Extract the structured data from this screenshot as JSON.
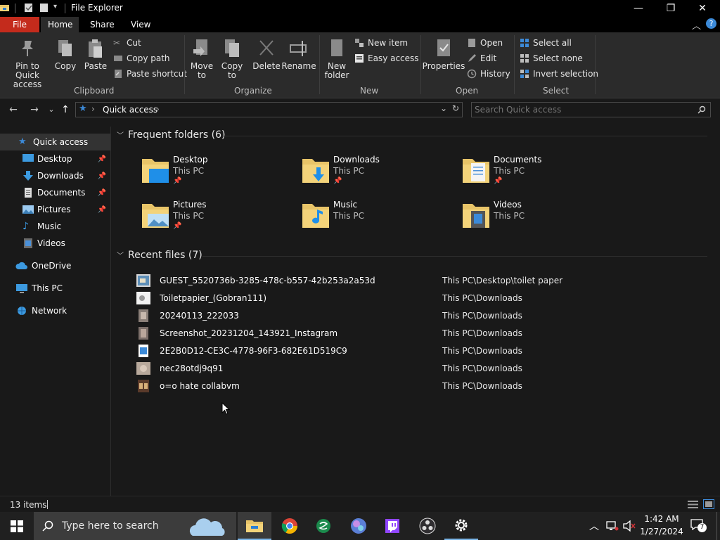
{
  "window": {
    "title": "File Explorer",
    "minimize_glyph": "—",
    "maximize_glyph": "❐",
    "close_glyph": "✕",
    "qat_dropdown": "▾"
  },
  "tabs": [
    {
      "label": "File"
    },
    {
      "label": "Home"
    },
    {
      "label": "Share"
    },
    {
      "label": "View"
    }
  ],
  "ribbon_right": {
    "collapse": "︿",
    "help": "?"
  },
  "ribbon": {
    "clipboard": {
      "pin_label": "Pin to Quick access",
      "copy_label": "Copy",
      "paste_label": "Paste",
      "cut": "Cut",
      "copy_path": "Copy path",
      "paste_shortcut": "Paste shortcut",
      "group": "Clipboard"
    },
    "organize": {
      "move_to": "Move to",
      "copy_to": "Copy to",
      "delete": "Delete",
      "rename": "Rename",
      "group": "Organize"
    },
    "new": {
      "new_folder": "New folder",
      "new_item": "New item",
      "easy_access": "Easy access",
      "group": "New"
    },
    "open": {
      "properties": "Properties",
      "open": "Open",
      "edit": "Edit",
      "history": "History",
      "group": "Open"
    },
    "select": {
      "select_all": "Select all",
      "select_none": "Select none",
      "invert": "Invert selection",
      "group": "Select"
    }
  },
  "address": {
    "back": "←",
    "forward": "→",
    "recent": "⌄",
    "up": "↑",
    "location": "Quick access",
    "separator": "›",
    "dropdown": "⌄",
    "refresh": "↻",
    "search_placeholder": "Search Quick access"
  },
  "sidebar": {
    "items": [
      {
        "label": "Quick access",
        "icon": "star-icon"
      },
      {
        "label": "Desktop",
        "icon": "desktop-icon",
        "pinned": true
      },
      {
        "label": "Downloads",
        "icon": "download-icon",
        "pinned": true
      },
      {
        "label": "Documents",
        "icon": "document-icon",
        "pinned": true
      },
      {
        "label": "Pictures",
        "icon": "pictures-icon",
        "pinned": true
      },
      {
        "label": "Music",
        "icon": "music-icon"
      },
      {
        "label": "Videos",
        "icon": "videos-icon"
      },
      {
        "label": "OneDrive",
        "icon": "cloud-icon"
      },
      {
        "label": "This PC",
        "icon": "computer-icon"
      },
      {
        "label": "Network",
        "icon": "network-icon"
      }
    ]
  },
  "frequent": {
    "heading": "Frequent folders (6)",
    "folders": [
      {
        "name": "Desktop",
        "location": "This PC",
        "pinned": true
      },
      {
        "name": "Downloads",
        "location": "This PC",
        "pinned": true
      },
      {
        "name": "Documents",
        "location": "This PC",
        "pinned": true
      },
      {
        "name": "Pictures",
        "location": "This PC",
        "pinned": true
      },
      {
        "name": "Music",
        "location": "This PC",
        "pinned": false
      },
      {
        "name": "Videos",
        "location": "This PC",
        "pinned": false
      }
    ]
  },
  "recent": {
    "heading": "Recent files (7)",
    "files": [
      {
        "name": "GUEST_5520736b-3285-478c-b557-42b253a2a53d",
        "path": "This PC\\Desktop\\toilet paper"
      },
      {
        "name": "Toiletpapier_(Gobran111)",
        "path": "This PC\\Downloads"
      },
      {
        "name": "20240113_222033",
        "path": "This PC\\Downloads"
      },
      {
        "name": "Screenshot_20231204_143921_Instagram",
        "path": "This PC\\Downloads"
      },
      {
        "name": "2E2B0D12-CE3C-4778-96F3-682E61D519C9",
        "path": "This PC\\Downloads"
      },
      {
        "name": "nec28otdj9q91",
        "path": "This PC\\Downloads"
      },
      {
        "name": "o=o hate collabvm",
        "path": "This PC\\Downloads"
      }
    ]
  },
  "status": {
    "count": "13 items"
  },
  "taskbar": {
    "search_placeholder": "Type here to search",
    "time": "1:42 AM",
    "date": "1/27/2024",
    "notifications": "7",
    "tray_chevron": "︿"
  },
  "colors": {
    "accent": "#0078d4",
    "folder": "#e8c468",
    "file_tab": "#c42b1c"
  }
}
